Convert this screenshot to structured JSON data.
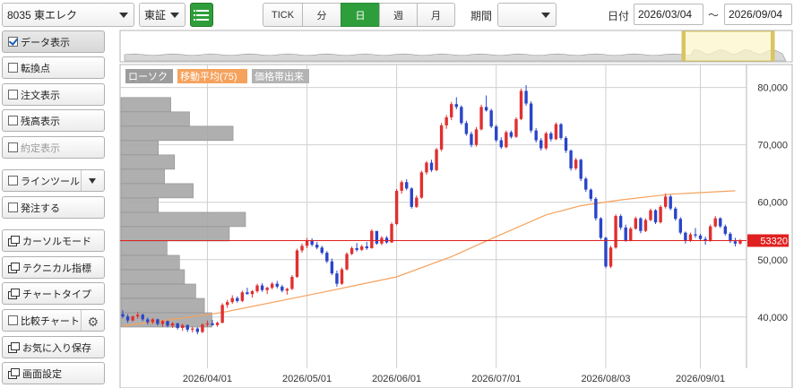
{
  "toolbar": {
    "symbol": "8035 東エレク",
    "market": "東証",
    "tabs": [
      "TICK",
      "分",
      "日",
      "週",
      "月"
    ],
    "active_tab": "日",
    "period_label": "期間",
    "period_value": "",
    "date_label": "日付",
    "date_from": "2026/03/04",
    "date_sep": "〜",
    "date_to": "2026/09/04"
  },
  "sidebar": {
    "items": [
      {
        "label": "データ表示",
        "type": "checkbox",
        "checked": true
      },
      {
        "label": "転換点",
        "type": "checkbox",
        "checked": false
      },
      {
        "label": "注文表示",
        "type": "checkbox",
        "checked": false
      },
      {
        "label": "残高表示",
        "type": "checkbox",
        "checked": false
      },
      {
        "label": "約定表示",
        "type": "checkbox",
        "checked": false,
        "disabled": true
      },
      {
        "label": "ラインツール",
        "type": "checkbox",
        "checked": false,
        "dropdown": true
      },
      {
        "label": "発注する",
        "type": "checkbox",
        "checked": false
      },
      {
        "label": "カーソルモード",
        "type": "window"
      },
      {
        "label": "テクニカル指標",
        "type": "window"
      },
      {
        "label": "チャートタイプ",
        "type": "window"
      },
      {
        "label": "比較チャート",
        "type": "checkbox",
        "checked": false,
        "gear": true
      },
      {
        "label": "お気に入り保存",
        "type": "window"
      },
      {
        "label": "画面設定",
        "type": "window"
      }
    ]
  },
  "legend": {
    "candle": "ローソク",
    "ma": "移動平均(75)",
    "volume_profile": "価格帯出来"
  },
  "colors": {
    "up": "#e03030",
    "down": "#2a45c8",
    "ma": "#f5a25d",
    "profile": "#a6a6a6",
    "current_line": "#e02020",
    "active_tab": "#2e9e3a"
  },
  "chart_data": {
    "type": "candlestick",
    "ylim": [
      35000,
      85000
    ],
    "y_ticks": [
      40000,
      50000,
      60000,
      70000,
      80000
    ],
    "y_tick_labels": [
      "40,000",
      "50,000",
      "60,000",
      "70,000",
      "80,000"
    ],
    "x_tick_labels": [
      "2026/04/01",
      "2026/05/01",
      "2026/06/01",
      "2026/07/01",
      "2026/08/03",
      "2026/09/01"
    ],
    "x_tick_index": [
      17,
      37,
      55,
      75,
      97,
      116
    ],
    "current_price": 53320,
    "current_price_label": "53320",
    "ma_points": [
      [
        0,
        38400
      ],
      [
        20,
        40800
      ],
      [
        40,
        44300
      ],
      [
        55,
        47000
      ],
      [
        66,
        50500
      ],
      [
        75,
        54000
      ],
      [
        85,
        57800
      ],
      [
        92,
        59400
      ],
      [
        100,
        60400
      ],
      [
        110,
        61400
      ],
      [
        123,
        62000
      ]
    ],
    "volume_profile": [
      {
        "price": 77000,
        "volume": 0.4
      },
      {
        "price": 74500,
        "volume": 0.55
      },
      {
        "price": 72000,
        "volume": 0.9
      },
      {
        "price": 69500,
        "volume": 0.3
      },
      {
        "price": 67000,
        "volume": 0.43
      },
      {
        "price": 64500,
        "volume": 0.35
      },
      {
        "price": 62000,
        "volume": 0.58
      },
      {
        "price": 59500,
        "volume": 0.3
      },
      {
        "price": 57000,
        "volume": 1.0
      },
      {
        "price": 54500,
        "volume": 0.87
      },
      {
        "price": 52000,
        "volume": 0.37
      },
      {
        "price": 49500,
        "volume": 0.47
      },
      {
        "price": 47000,
        "volume": 0.51
      },
      {
        "price": 44500,
        "volume": 0.6
      },
      {
        "price": 42000,
        "volume": 0.67
      },
      {
        "price": 39500,
        "volume": 0.73
      }
    ],
    "ohlc": [
      [
        40500,
        41200,
        39800,
        40100
      ],
      [
        40100,
        40500,
        39000,
        39400
      ],
      [
        39400,
        40300,
        39200,
        40100
      ],
      [
        40100,
        40900,
        39700,
        40400
      ],
      [
        40400,
        40600,
        39300,
        39600
      ],
      [
        39600,
        39900,
        38700,
        39100
      ],
      [
        39100,
        39800,
        38800,
        39600
      ],
      [
        39600,
        39700,
        38500,
        38800
      ],
      [
        38800,
        39500,
        38300,
        39300
      ],
      [
        39300,
        39400,
        38200,
        38500
      ],
      [
        38500,
        39100,
        38100,
        38900
      ],
      [
        38900,
        39000,
        37800,
        38100
      ],
      [
        38100,
        38800,
        37600,
        38600
      ],
      [
        38600,
        38700,
        37400,
        37800
      ],
      [
        37800,
        38300,
        37300,
        38000
      ],
      [
        38000,
        38200,
        37000,
        37400
      ],
      [
        37400,
        38900,
        37200,
        38700
      ],
      [
        38700,
        39400,
        38300,
        38900
      ],
      [
        38900,
        39500,
        38500,
        38600
      ],
      [
        38600,
        39200,
        38300,
        39000
      ],
      [
        39000,
        42400,
        38900,
        42100
      ],
      [
        42100,
        43000,
        41600,
        42600
      ],
      [
        42600,
        43800,
        42300,
        43300
      ],
      [
        43300,
        43600,
        42500,
        42800
      ],
      [
        42800,
        44600,
        42600,
        44300
      ],
      [
        44300,
        45100,
        43900,
        44000
      ],
      [
        44000,
        44700,
        43400,
        44500
      ],
      [
        44500,
        45800,
        44200,
        45500
      ],
      [
        45500,
        45900,
        44400,
        44700
      ],
      [
        44700,
        45300,
        44000,
        45100
      ],
      [
        45100,
        46100,
        44800,
        45800
      ],
      [
        45800,
        46300,
        45000,
        45300
      ],
      [
        45300,
        45600,
        44300,
        44600
      ],
      [
        44600,
        45100,
        43900,
        44900
      ],
      [
        44900,
        47300,
        44700,
        47000
      ],
      [
        47000,
        51900,
        46800,
        51600
      ],
      [
        51600,
        52800,
        51200,
        52400
      ],
      [
        52400,
        53800,
        52000,
        53400
      ],
      [
        53400,
        53700,
        52300,
        52600
      ],
      [
        52600,
        53100,
        51800,
        52100
      ],
      [
        52100,
        52400,
        50900,
        51200
      ],
      [
        51200,
        51500,
        49400,
        49700
      ],
      [
        49700,
        50200,
        47300,
        47600
      ],
      [
        47600,
        48100,
        45300,
        45800
      ],
      [
        45800,
        48600,
        45600,
        48300
      ],
      [
        48300,
        51300,
        48100,
        51000
      ],
      [
        51000,
        52300,
        50800,
        52000
      ],
      [
        52000,
        52900,
        51400,
        51700
      ],
      [
        51700,
        52600,
        51500,
        52300
      ],
      [
        52300,
        53100,
        51700,
        52000
      ],
      [
        52000,
        55300,
        51900,
        55000
      ],
      [
        55000,
        54900,
        52600,
        52800
      ],
      [
        52800,
        54100,
        52500,
        53800
      ],
      [
        53800,
        54100,
        52800,
        53000
      ],
      [
        53000,
        56500,
        52900,
        56200
      ],
      [
        56200,
        62300,
        56000,
        62000
      ],
      [
        62000,
        63800,
        61500,
        63500
      ],
      [
        63500,
        64000,
        62100,
        62400
      ],
      [
        62400,
        62600,
        58900,
        59200
      ],
      [
        59200,
        61200,
        59000,
        60800
      ],
      [
        60800,
        65500,
        60600,
        65200
      ],
      [
        65200,
        67200,
        64800,
        66900
      ],
      [
        66900,
        67400,
        65300,
        65600
      ],
      [
        65600,
        69500,
        65400,
        69200
      ],
      [
        69200,
        73800,
        68900,
        73400
      ],
      [
        73400,
        75200,
        72800,
        74800
      ],
      [
        74800,
        77500,
        74300,
        77100
      ],
      [
        77100,
        78300,
        76200,
        76600
      ],
      [
        76600,
        76900,
        73500,
        73800
      ],
      [
        73800,
        74200,
        71600,
        71900
      ],
      [
        71900,
        72300,
        69600,
        70000
      ],
      [
        70000,
        73100,
        69700,
        72700
      ],
      [
        72700,
        77000,
        72500,
        76600
      ],
      [
        76600,
        78600,
        75800,
        76000
      ],
      [
        76000,
        76300,
        72900,
        73200
      ],
      [
        73200,
        73500,
        70500,
        70800
      ],
      [
        70800,
        71300,
        69300,
        69600
      ],
      [
        69600,
        72500,
        69400,
        72200
      ],
      [
        72200,
        72500,
        71100,
        71400
      ],
      [
        71400,
        74800,
        71200,
        74500
      ],
      [
        74500,
        79800,
        74300,
        79400
      ],
      [
        79400,
        80400,
        76800,
        77200
      ],
      [
        77200,
        77600,
        72100,
        72500
      ],
      [
        72500,
        72900,
        70400,
        70800
      ],
      [
        70800,
        71200,
        69000,
        69400
      ],
      [
        69400,
        72300,
        69100,
        72000
      ],
      [
        72000,
        72300,
        70600,
        71000
      ],
      [
        71000,
        73900,
        70800,
        73600
      ],
      [
        73600,
        73800,
        70900,
        71200
      ],
      [
        71200,
        71500,
        68600,
        69000
      ],
      [
        69000,
        69200,
        65500,
        65900
      ],
      [
        65900,
        67700,
        65600,
        67400
      ],
      [
        67400,
        67600,
        63700,
        64100
      ],
      [
        64100,
        64400,
        61800,
        62200
      ],
      [
        62200,
        62400,
        60200,
        60600
      ],
      [
        60600,
        60900,
        56800,
        57200
      ],
      [
        57200,
        57400,
        53500,
        53800
      ],
      [
        53800,
        54000,
        48500,
        48800
      ],
      [
        48800,
        52400,
        48500,
        52100
      ],
      [
        52100,
        57900,
        51900,
        57600
      ],
      [
        57600,
        57900,
        55200,
        55600
      ],
      [
        55600,
        56100,
        53100,
        53400
      ],
      [
        53400,
        55700,
        53200,
        55400
      ],
      [
        55400,
        57500,
        55200,
        57200
      ],
      [
        57200,
        57400,
        54600,
        55000
      ],
      [
        55000,
        57200,
        54800,
        56900
      ],
      [
        56900,
        58900,
        56700,
        58600
      ],
      [
        58600,
        58800,
        56200,
        56500
      ],
      [
        56500,
        59500,
        56300,
        59200
      ],
      [
        59200,
        61500,
        58900,
        61000
      ],
      [
        61000,
        61300,
        58600,
        58900
      ],
      [
        58900,
        59200,
        56800,
        57100
      ],
      [
        57100,
        57400,
        54400,
        54700
      ],
      [
        54700,
        54900,
        52800,
        53300
      ],
      [
        53300,
        54700,
        53100,
        54400
      ],
      [
        54400,
        55500,
        53800,
        54200
      ],
      [
        54200,
        54500,
        53300,
        53600
      ],
      [
        53600,
        54000,
        52600,
        53300
      ],
      [
        53300,
        56100,
        53100,
        55800
      ],
      [
        55800,
        57600,
        55600,
        57200
      ],
      [
        57200,
        57400,
        55500,
        55800
      ],
      [
        55800,
        56100,
        54200,
        54500
      ],
      [
        54500,
        54800,
        52900,
        53200
      ],
      [
        53200,
        53800,
        52300,
        52800
      ],
      [
        52800,
        53600,
        52600,
        53320
      ]
    ]
  }
}
